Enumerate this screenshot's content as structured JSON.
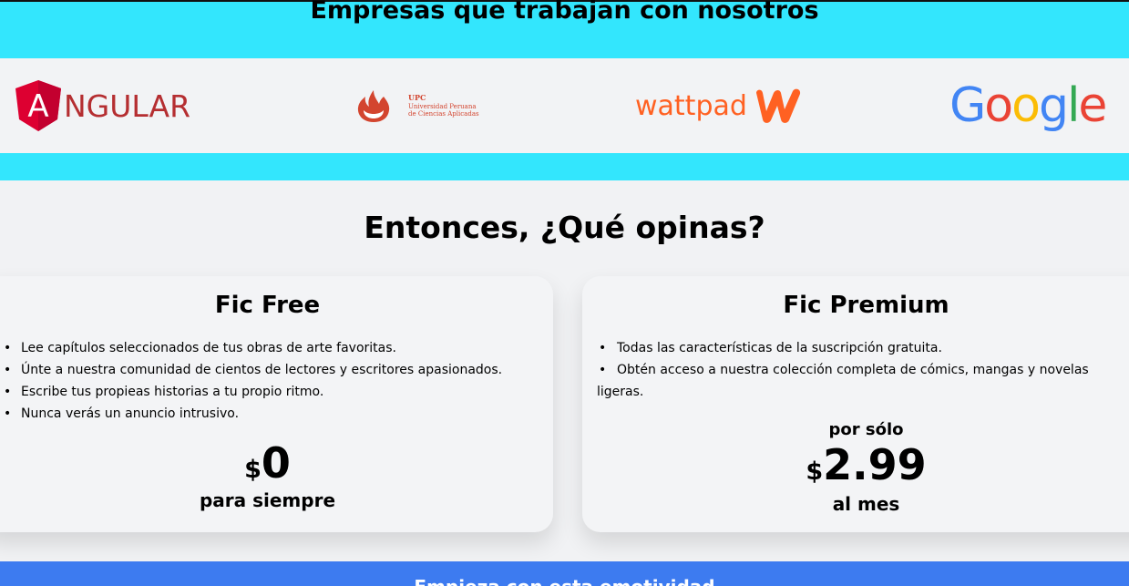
{
  "partners": {
    "title": "Empresas que trabajan con nosotros",
    "logos": [
      {
        "name": "angular-logo",
        "word": "NGULAR",
        "badge_letter": "A",
        "color": "#b52e31"
      },
      {
        "name": "upc-logo",
        "line1": "UPC",
        "line2": "Universidad Peruana",
        "line3": "de Ciencias Aplicadas",
        "color": "#d3452f"
      },
      {
        "name": "wattpad-logo",
        "word": "wattpad",
        "color": "#ff6122"
      },
      {
        "name": "google-logo",
        "word": [
          "G",
          "o",
          "o",
          "g",
          "l",
          "e"
        ]
      }
    ],
    "band_color": "#33e6fd"
  },
  "pricing": {
    "title": "Entonces, ¿Qué opinas?",
    "plans": [
      {
        "title": "Fic Free",
        "features": [
          "Lee capítulos seleccionados de tus obras de arte favoritas.",
          "Únte a nuestra comunidad de cientos de lectores y escritores apasionados.",
          "Escribe tus propieas historias a tu propio ritmo.",
          "Nunca verás un anuncio intrusivo."
        ],
        "currency": "$",
        "amount": "0",
        "period": "para siempre"
      },
      {
        "title": "Fic Premium",
        "features": [
          "Todas las características de la suscripción gratuita.",
          "Obtén acceso a nuestra colección completa de cómics, mangas y novelas ligeras."
        ],
        "price_prefix": "por sólo",
        "currency": "$",
        "amount": "2.99",
        "period": "al mes"
      }
    ]
  },
  "footer": {
    "text": "Empieza con esta emotividad",
    "band_color": "#3d7bf0"
  }
}
